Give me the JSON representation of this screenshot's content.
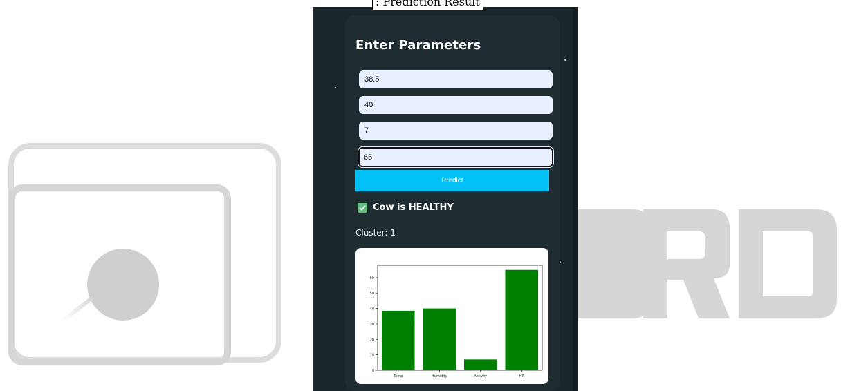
{
  "caption": ": Prediction Result",
  "form": {
    "title": "Enter Parameters",
    "fields": [
      {
        "value": "38.5"
      },
      {
        "value": "40"
      },
      {
        "value": "7"
      },
      {
        "value": "65"
      }
    ],
    "predict_label": "Predict"
  },
  "result": {
    "status_icon": "check-icon",
    "status_text": "Cow is HEALTHY",
    "status_color": "#5fbe7e",
    "cluster_text": "Cluster: 1"
  },
  "colors": {
    "background": "#1a262b",
    "card": "#1f2d33",
    "accent": "#00c0f6",
    "bar": "#008000"
  },
  "chart_data": {
    "type": "bar",
    "categories": [
      "Temp",
      "Humidity",
      "Activity",
      "HR"
    ],
    "values": [
      38.5,
      40,
      7,
      65
    ],
    "title": "",
    "xlabel": "",
    "ylabel": "",
    "ylim": [
      0,
      68
    ],
    "yticks": [
      0,
      10,
      20,
      30,
      40,
      50,
      60
    ],
    "grid": false,
    "color": "#008000"
  }
}
